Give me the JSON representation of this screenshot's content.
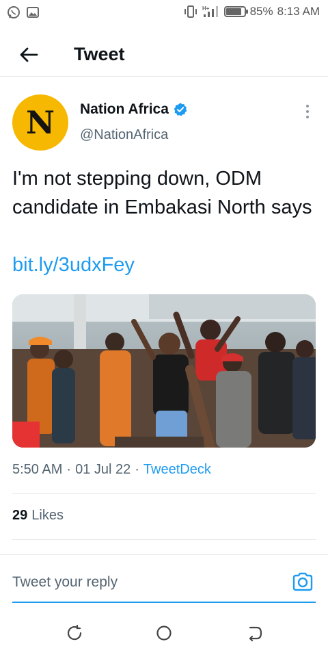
{
  "status_bar": {
    "battery": "85%",
    "time": "8:13 AM",
    "network": "4G",
    "battery_level": 0.85
  },
  "header": {
    "title": "Tweet"
  },
  "author": {
    "avatar_letter": "N",
    "name": "Nation Africa",
    "handle": "@NationAfrica",
    "avatar_color": "#f6b800"
  },
  "tweet": {
    "text": "I'm not stepping down, ODM candidate in Embakasi North says",
    "link": "bit.ly/3udxFey",
    "time": "5:50 AM",
    "separator": "·",
    "date": "01 Jul 22",
    "source": "TweetDeck",
    "likes_count": "29",
    "likes_label": "Likes"
  },
  "reply": {
    "placeholder": "Tweet your reply"
  },
  "colors": {
    "accent": "#1d9bf0",
    "text": "#0f1419",
    "muted": "#536471"
  },
  "icons": {
    "back": "arrow-left-icon",
    "verified": "verified-badge-icon",
    "more": "more-vertical-icon",
    "camera": "camera-icon"
  }
}
